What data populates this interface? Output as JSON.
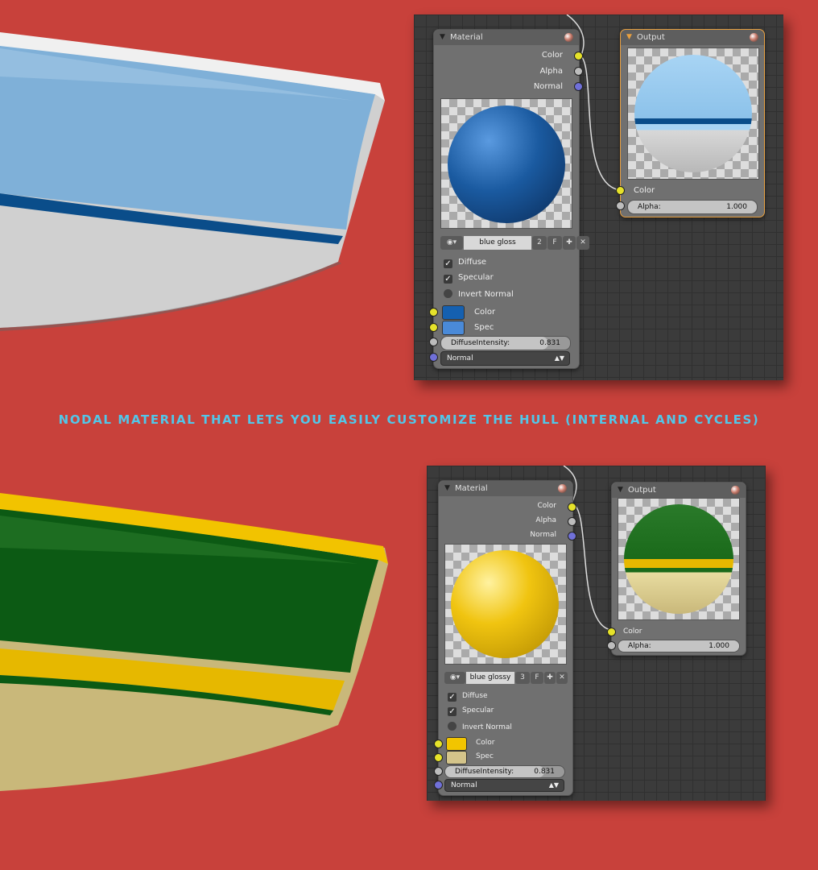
{
  "caption": "NODAL MATERIAL THAT LETS YOU EASILY CUSTOMIZE THE HULL (INTERNAL AND CYCLES)",
  "colors": {
    "background": "#c8413b",
    "caption": "#52c6e8",
    "socket_color": "#e6e22a",
    "socket_alpha": "#bdbdbd",
    "socket_normal": "#7070d8"
  },
  "panels": [
    {
      "material_node": {
        "title": "Material",
        "outputs": [
          "Color",
          "Alpha",
          "Normal"
        ],
        "material_name": "blue gloss",
        "users": "2",
        "fake_user": "F",
        "checkboxes": [
          {
            "label": "Diffuse",
            "checked": true
          },
          {
            "label": "Specular",
            "checked": true
          },
          {
            "label": "Invert Normal",
            "checked": false
          }
        ],
        "color_label": "Color",
        "color_value": "#1560b0",
        "spec_label": "Spec",
        "spec_value": "#4a8ad8",
        "intensity_label": "DiffuseIntensity:",
        "intensity_value": "0.831",
        "normal_select": "Normal",
        "sphere_color": "#1a5aa0"
      },
      "output_node": {
        "title": "Output",
        "color_label": "Color",
        "alpha_label": "Alpha:",
        "alpha_value": "1.000"
      },
      "hull_colors": {
        "top": "#7fb0d8",
        "stripe": "#0a4d8a",
        "bottom": "#d0d0d0",
        "rim": "#f0f0f0"
      }
    },
    {
      "material_node": {
        "title": "Material",
        "outputs": [
          "Color",
          "Alpha",
          "Normal"
        ],
        "material_name": "blue glossy",
        "users": "3",
        "fake_user": "F",
        "checkboxes": [
          {
            "label": "Diffuse",
            "checked": true
          },
          {
            "label": "Specular",
            "checked": true
          },
          {
            "label": "Invert Normal",
            "checked": false
          }
        ],
        "color_label": "Color",
        "color_value": "#f2c500",
        "spec_label": "Spec",
        "spec_value": "#d4c48a",
        "intensity_label": "DiffuseIntensity:",
        "intensity_value": "0.831",
        "normal_select": "Normal",
        "sphere_color": "#f0c410"
      },
      "output_node": {
        "title": "Output",
        "color_label": "Color",
        "alpha_label": "Alpha:",
        "alpha_value": "1.000"
      },
      "hull_colors": {
        "top": "#0c5a14",
        "stripe": "#e6b800",
        "bottom": "#c9b87a",
        "rim": "#f2c300"
      }
    }
  ]
}
